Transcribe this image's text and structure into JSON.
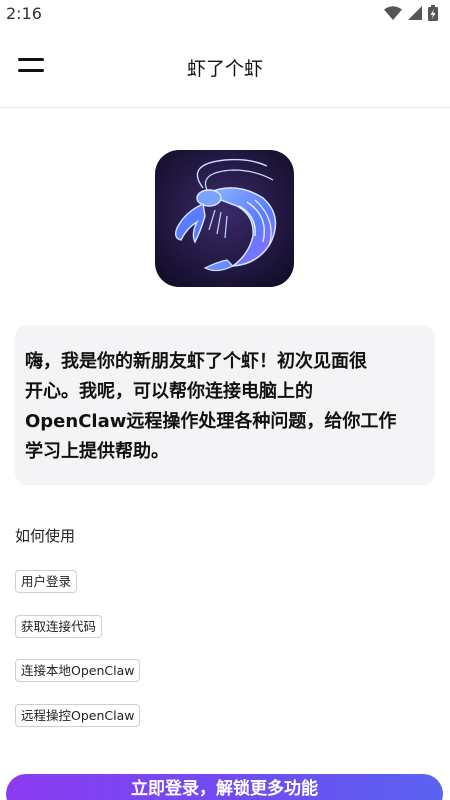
{
  "status_bar": {
    "time": "2:16",
    "icons": [
      "wifi-icon",
      "signal-icon",
      "battery-charging-icon"
    ]
  },
  "header": {
    "menu_icon": "hamburger-menu-icon",
    "title": "虾了个虾"
  },
  "logo": {
    "icon": "neon-shrimp-app-icon",
    "colors": {
      "background": "#1c1436",
      "glow_blue": "#4a8dff",
      "glow_purple": "#9a5cff"
    }
  },
  "intro": {
    "lines": [
      "嗨，我是你的新朋友虾了个虾！初次见面很",
      "开心。我呢，可以帮你连接电脑上的",
      "OpenClaw远程操作处理各种问题，给你工作",
      "学习上提供帮助。"
    ]
  },
  "how_to_use": {
    "title": "如何使用",
    "items": [
      "用户登录",
      "获取连接代码",
      "连接本地OpenClaw",
      "远程操控OpenClaw"
    ]
  },
  "cta": {
    "label": "立即登录，解锁更多功能",
    "colors": {
      "start": "#8b3cf0",
      "end": "#5a63f0"
    }
  }
}
